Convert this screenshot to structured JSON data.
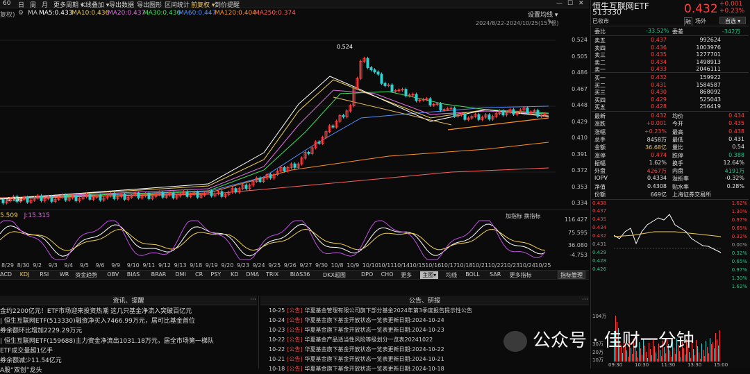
{
  "toolbar": {
    "items": [
      "60",
      "日",
      "周",
      "月",
      "更多周期 ▾",
      "K线叠加 ▾",
      "导出数据",
      "导出图形",
      "区间统计",
      "前复权 ▾",
      "到价提醒"
    ],
    "window_controls": [
      "—",
      "☐",
      "✕"
    ]
  },
  "chart_header": {
    "adjust": "复权)",
    "ma_label": "MA",
    "ma5": "MA5:0.433",
    "ma10": "MA10:0.436",
    "ma20": "MA20:0.437",
    "ma30": "MA30:0.436",
    "ma60": "MA60:0.447",
    "ma120": "MA120:0.404",
    "ma250": "MA250:0.374",
    "settings": "设置均线 ▾",
    "range": "2024/8/22-2024/10/25(157根)"
  },
  "colors": {
    "up": "#ff4040",
    "down": "#30d0d0",
    "ma5": "#ffffff",
    "ma10": "#f0d050",
    "ma20": "#e070e0",
    "ma30": "#40e060",
    "ma60": "#5080ff",
    "ma120": "#ff9020",
    "ma250": "#ff6060"
  },
  "price_axis": [
    "0.524",
    "0.505",
    "0.486",
    "0.467",
    "0.448",
    "0.429",
    "0.410",
    "0.391",
    "0.372",
    "0.353",
    "0.334"
  ],
  "price_annotations": {
    "high": "0.524",
    "low": "0.334"
  },
  "kdj_header": {
    "v1": "5.509",
    "v2": "J:15.315",
    "right": "加指标  换指标"
  },
  "kdj_axis": [
    "116.427",
    "75.595",
    "36.080",
    "-4.753"
  ],
  "dates": [
    "8/29",
    "8/30",
    "9/2",
    "9/3",
    "9/4",
    "9/5",
    "9/6",
    "9/9",
    "9/10",
    "9/11",
    "9/12",
    "9/13",
    "9/18",
    "9/19",
    "9/20",
    "9/23",
    "9/24",
    "9/25",
    "9/26",
    "9/27",
    "9/30",
    "10/8",
    "10/9",
    "10/10",
    "10/11",
    "10/14",
    "10/15",
    "10/16",
    "10/17",
    "10/18",
    "10/21",
    "10/22",
    "10/23",
    "10/24",
    "10/25"
  ],
  "indicator_tabs": [
    "ACD",
    "KDJ",
    "RSI",
    "WR",
    "资金趋势",
    "OBV",
    "BIAS",
    "BRAR",
    "DMI",
    "CR",
    "PSY",
    "KD",
    "DMA",
    "TRIX",
    "BIAS36",
    "DKX超图",
    "DPO",
    "CHO",
    "更多",
    "主图▾",
    "均线",
    "BOLL",
    "SAR",
    "更多指标"
  ],
  "indicator_mgmt": "指标管理",
  "news": {
    "title": "资讯、提醒",
    "items": [
      "金约2200亿元！ETF市场迎来投资热潮 这几只基金净流入突破百亿元",
      "| 恒生互联网ETF(513330)融资净买入7466.99万元，居可比基金首位",
      "券余额环比增加2229.29万元",
      "| 恒生互联网ETF(159688)主力资金净流出1031.18万元，居全市场第一梯队",
      "ETF成交量超1亿手",
      "券余额减少11.54亿元",
      "A股“双创”龙头"
    ]
  },
  "announcements": {
    "title": "公告、研报",
    "items": [
      {
        "date": "10-25",
        "tag": "[公告]",
        "text": "华夏基金管理有限公司旗下部分基金2024年第3季度报告提示性公告"
      },
      {
        "date": "10-24",
        "tag": "[公告]",
        "text": "华夏基金旗下基金开放状态一览表更新日期:2024-10-24"
      },
      {
        "date": "10-23",
        "tag": "[公告]",
        "text": "华夏基金旗下基金开放状态一览表更新日期:2024-10-23"
      },
      {
        "date": "10-22",
        "tag": "[公告]",
        "text": "华夏基金产品适当性风险等级划分一览表20241022"
      },
      {
        "date": "10-22",
        "tag": "[公告]",
        "text": "华夏基金旗下基金开放状态一览表更新日期:2024-10-22"
      },
      {
        "date": "10-21",
        "tag": "[公告]",
        "text": "华夏基金旗下基金开放状态一览表更新日期:2024-10-21"
      },
      {
        "date": "10-18",
        "tag": "[公告]",
        "text": "华夏基金旗下基金开放状态一览表更新日期:2024-10-18"
      }
    ]
  },
  "quote": {
    "name": "恒生互联网ETF",
    "code": "513330",
    "status": "已收市",
    "price": "0.432",
    "change": "+0.001",
    "change_pct": "+0.23%",
    "icons": [
      "融",
      "场外"
    ],
    "watch": "自选 ▾",
    "weibi_label": "委比",
    "weibi": "-33.52%",
    "weicha_label": "委差",
    "weicha": "-342万",
    "asks": [
      {
        "label": "卖五",
        "price": "0.437",
        "vol": "992624"
      },
      {
        "label": "卖四",
        "price": "0.436",
        "vol": "1003976"
      },
      {
        "label": "卖三",
        "price": "0.435",
        "vol": "1277701"
      },
      {
        "label": "卖二",
        "price": "0.434",
        "vol": "1498913"
      },
      {
        "label": "卖一",
        "price": "0.433",
        "vol": "2046111"
      }
    ],
    "bids": [
      {
        "label": "买一",
        "price": "0.432",
        "vol": "159922"
      },
      {
        "label": "买二",
        "price": "0.431",
        "vol": "1584587"
      },
      {
        "label": "买三",
        "price": "0.430",
        "vol": "868092"
      },
      {
        "label": "买四",
        "price": "0.429",
        "vol": "525043"
      },
      {
        "label": "买五",
        "price": "0.428",
        "vol": "256419"
      }
    ],
    "stats": [
      {
        "l1": "最新",
        "v1": "0.432",
        "c1": "red",
        "l2": "均价",
        "v2": "0.434",
        "c2": "red"
      },
      {
        "l1": "涨跌",
        "v1": "+0.001",
        "c1": "red",
        "l2": "今开",
        "v2": "0.435",
        "c2": "red"
      },
      {
        "l1": "涨幅",
        "v1": "+0.23%",
        "c1": "red",
        "l2": "最高",
        "v2": "0.438",
        "c2": "red"
      },
      {
        "l1": "总手",
        "v1": "8458万",
        "c1": "white",
        "l2": "最低",
        "v2": "0.431",
        "c2": "white"
      },
      {
        "l1": "金额",
        "v1": "36.68亿",
        "c1": "yellow",
        "l2": "量比",
        "v2": "0.54",
        "c2": "white"
      },
      {
        "l1": "涨停",
        "v1": "0.474",
        "c1": "red",
        "l2": "跌停",
        "v2": "0.388",
        "c2": "green"
      },
      {
        "l1": "振幅",
        "v1": "1.62%",
        "c1": "white",
        "l2": "换手",
        "v2": "12.64%",
        "c2": "white"
      },
      {
        "l1": "外盘",
        "v1": "4267万",
        "c1": "red",
        "l2": "内盘",
        "v2": "4191万",
        "c2": "green"
      },
      {
        "l1": "IOPV",
        "v1": "0.4334",
        "c1": "white",
        "l2": "溢折率",
        "v2": "-0.32%",
        "c2": "white"
      },
      {
        "l1": "净值",
        "v1": "0.4308",
        "c1": "white",
        "l2": "贴水率",
        "v2": "0.28%",
        "c2": "white"
      },
      {
        "l1": "份额",
        "v1": "669亿",
        "c1": "white",
        "l2": "上海证券交易所",
        "v2": "",
        "c2": "white"
      }
    ],
    "intraday_price_axis": [
      "0.438",
      "0.437",
      "0.435",
      "0.434",
      "0.432",
      "0.431",
      "0.429",
      "0.428",
      "0.426"
    ],
    "intraday_pct_axis": [
      "1.62%",
      "1.30%",
      "0.97%",
      "0.65%",
      "0.32%",
      "0.00%",
      "0.32%",
      "0.65%",
      "0.97%",
      "1.30%",
      "1.62%"
    ],
    "volume_axis": [
      "104万",
      "",
      "",
      "",
      "",
      "",
      "",
      "30万",
      "20万",
      "10万"
    ],
    "time_axis": [
      "09:30",
      "10:30",
      "11:30",
      "13:30",
      "15:00"
    ]
  },
  "watermark": "公众号 · 佳财一分钟"
}
